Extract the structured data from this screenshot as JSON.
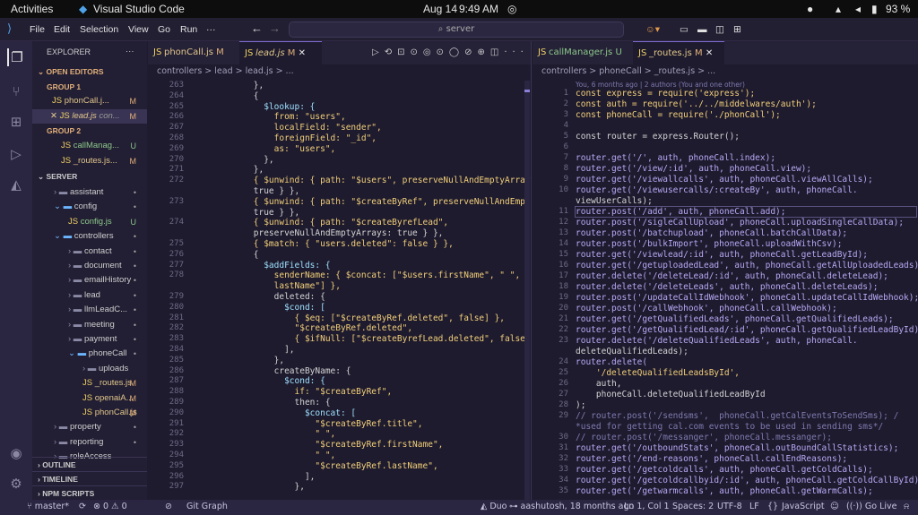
{
  "topbar": {
    "activities": "Activities",
    "app": "Visual Studio Code",
    "date": "Aug 14",
    "time": "9:49 AM",
    "battery": "93 %"
  },
  "menu": {
    "items": [
      "File",
      "Edit",
      "Selection",
      "View",
      "Go",
      "Run"
    ],
    "search": "server"
  },
  "sidebar": {
    "title": "EXPLORER",
    "open_editors": "OPEN EDITORS",
    "group1": "GROUP 1",
    "g1_files": [
      {
        "name": "phonCall.j...",
        "status": "M"
      },
      {
        "name": "lead.js",
        "extra": "con...",
        "status": "M"
      }
    ],
    "group2": "GROUP 2",
    "g2_files": [
      {
        "name": "callManag...",
        "status": "U"
      },
      {
        "name": "_routes.js...",
        "status": "M"
      }
    ],
    "server": "SERVER",
    "tree": [
      {
        "name": "assistant",
        "type": "folder",
        "status": "•"
      },
      {
        "name": "config",
        "type": "folder-open",
        "status": "•"
      },
      {
        "name": "config.js",
        "type": "file",
        "status": "U"
      },
      {
        "name": "controllers",
        "type": "folder-open",
        "status": "•"
      },
      {
        "name": "contact",
        "type": "folder",
        "status": "•"
      },
      {
        "name": "document",
        "type": "folder",
        "status": "•"
      },
      {
        "name": "emailHistory",
        "type": "folder",
        "status": "•"
      },
      {
        "name": "lead",
        "type": "folder",
        "status": "•"
      },
      {
        "name": "llmLeadC...",
        "type": "folder",
        "status": "•"
      },
      {
        "name": "meeting",
        "type": "folder",
        "status": "•"
      },
      {
        "name": "payment",
        "type": "folder",
        "status": "•"
      },
      {
        "name": "phoneCall",
        "type": "folder-open",
        "status": "•"
      },
      {
        "name": "uploads",
        "type": "folder",
        "status": ""
      },
      {
        "name": "_routes.js",
        "type": "file",
        "status": "M"
      },
      {
        "name": "openaiA...",
        "type": "file",
        "status": "M"
      },
      {
        "name": "phonCall.js",
        "type": "file",
        "status": "M"
      },
      {
        "name": "property",
        "type": "folder",
        "status": "•"
      },
      {
        "name": "reporting",
        "type": "folder",
        "status": "•"
      },
      {
        "name": "roleAccess",
        "type": "folder",
        "status": ""
      }
    ],
    "outline": "OUTLINE",
    "timeline": "TIMELINE",
    "npm": "NPM SCRIPTS"
  },
  "left_editor": {
    "tabs": [
      {
        "name": "phonCall.js",
        "status": "M"
      },
      {
        "name": "lead.js",
        "status": "M"
      }
    ],
    "breadcrumb": "controllers > lead > lead.js > ...",
    "lines": [
      [
        "263",
        "        },"
      ],
      [
        "264",
        "        {"
      ],
      [
        "265",
        "          $lookup: {"
      ],
      [
        "266",
        "            from: \"users\","
      ],
      [
        "267",
        "            localField: \"sender\","
      ],
      [
        "268",
        "            foreignField: \"_id\","
      ],
      [
        "269",
        "            as: \"users\","
      ],
      [
        "270",
        "          },"
      ],
      [
        "271",
        "        },"
      ],
      [
        "272",
        "        { $unwind: { path: \"$users\", preserveNullAndEmptyArrays:"
      ],
      [
        "",
        "        true } },"
      ],
      [
        "273",
        "        { $unwind: { path: \"$createByRef\", preserveNullAndEmptyArrays:"
      ],
      [
        "",
        "        true } },"
      ],
      [
        "274",
        "        { $unwind: { path: \"$createByrefLead\","
      ],
      [
        "",
        "        preserveNullAndEmptyArrays: true } },"
      ],
      [
        "275",
        "        { $match: { \"users.deleted\": false } },"
      ],
      [
        "276",
        "        {"
      ],
      [
        "277",
        "          $addFields: {"
      ],
      [
        "278",
        "            senderName: { $concat: [\"$users.firstName\", \" \", \"$users."
      ],
      [
        "",
        "            lastName\"] },"
      ],
      [
        "279",
        "            deleted: {"
      ],
      [
        "280",
        "              $cond: ["
      ],
      [
        "281",
        "                { $eq: [\"$createByRef.deleted\", false] },"
      ],
      [
        "282",
        "                \"$createByRef.deleted\","
      ],
      [
        "283",
        "                { $ifNull: [\"$createByrefLead.deleted\", false] },"
      ],
      [
        "284",
        "              ],"
      ],
      [
        "285",
        "            },"
      ],
      [
        "286",
        "            createByName: {"
      ],
      [
        "287",
        "              $cond: {"
      ],
      [
        "288",
        "                if: \"$createByRef\","
      ],
      [
        "289",
        "                then: {"
      ],
      [
        "290",
        "                  $concat: ["
      ],
      [
        "291",
        "                    \"$createByRef.title\","
      ],
      [
        "292",
        "                    \" \","
      ],
      [
        "293",
        "                    \"$createByRef.firstName\","
      ],
      [
        "294",
        "                    \" \","
      ],
      [
        "295",
        "                    \"$createByRef.lastName\","
      ],
      [
        "296",
        "                  ],"
      ],
      [
        "297",
        "                },"
      ]
    ]
  },
  "right_editor": {
    "tabs": [
      {
        "name": "callManager.js",
        "status": "U"
      },
      {
        "name": "_routes.js",
        "status": "M"
      }
    ],
    "breadcrumb": "controllers > phoneCall > _routes.js > ...",
    "blame": "You, 6 months ago | 2 authors (You and one other)",
    "lines": [
      [
        "1",
        "const express = require('express');"
      ],
      [
        "2",
        "const auth = require('../../middelwares/auth');"
      ],
      [
        "3",
        "const phoneCall = require('./phonCall');"
      ],
      [
        "4",
        ""
      ],
      [
        "5",
        "const router = express.Router();"
      ],
      [
        "6",
        ""
      ],
      [
        "7",
        "router.get('/', auth, phoneCall.index);"
      ],
      [
        "8",
        "router.get('/view/:id', auth, phoneCall.view);"
      ],
      [
        "9",
        "router.get('/viewallcalls', auth, phoneCall.viewAllCalls);"
      ],
      [
        "10",
        "router.get('/viewusercalls/:createBy', auth, phoneCall."
      ],
      [
        "",
        "viewUserCalls);"
      ],
      [
        "11",
        "router.post('/add', auth, phoneCall.add);"
      ],
      [
        "12",
        "router.post('/sigleCallUpload', phoneCall.uploadSingleCallData);"
      ],
      [
        "13",
        "router.post('/batchupload', phoneCall.batchCallData);"
      ],
      [
        "14",
        "router.post('/bulkImport', phoneCall.uploadWithCsv);"
      ],
      [
        "15",
        "router.get('/viewlead/:id', auth, phoneCall.getLeadById);"
      ],
      [
        "16",
        "router.get('/getuploadedLead', auth, phoneCall.getAllUploadedLeads);"
      ],
      [
        "17",
        "router.delete('/deleteLead/:id', auth, phoneCall.deleteLead);"
      ],
      [
        "18",
        "router.delete('/deleteLeads', auth, phoneCall.deleteLeads);"
      ],
      [
        "19",
        "router.post('/updateCallIdWebhook', phoneCall.updateCallIdWebhook);"
      ],
      [
        "20",
        "router.post('/callWebhook', phoneCall.callWebhook);"
      ],
      [
        "21",
        "router.get('/getQualifiedLeads', phoneCall.getQualifiedLeads);"
      ],
      [
        "22",
        "router.get('/getQualifiedLead/:id', phoneCall.getQualifiedLeadById);"
      ],
      [
        "23",
        "router.delete('/deleteQualifiedLeads', auth, phoneCall."
      ],
      [
        "",
        "deleteQualifiedLeads);"
      ],
      [
        "24",
        "router.delete("
      ],
      [
        "25",
        "    '/deleteQualifiedLeadsById',"
      ],
      [
        "26",
        "    auth,"
      ],
      [
        "27",
        "    phoneCall.deleteQualifiedLeadById"
      ],
      [
        "28",
        ");"
      ],
      [
        "29",
        "// router.post('/sendsms',  phoneCall.getCalEventsToSendSms); /"
      ],
      [
        "",
        "*used for getting cal.com events to be used in sending sms*/"
      ],
      [
        "30",
        "// router.post('/messanger', phoneCall.messanger);"
      ],
      [
        "31",
        "router.get('/outboundStats', phoneCall.outBoundCallStatistics);"
      ],
      [
        "32",
        "router.get('/end-reasons', phoneCall.callEndReasons);"
      ],
      [
        "33",
        "router.get('/getcoldcalls', auth, phoneCall.getColdCalls);"
      ],
      [
        "34",
        "router.get('/getcoldcallbyid/:id', auth, phoneCall.getColdCallById);"
      ],
      [
        "35",
        "router.get('/getwarmcalls', auth, phoneCall.getWarmCalls);"
      ]
    ]
  },
  "status": {
    "branch": "master*",
    "errors": "0",
    "warnings": "0",
    "gitgraph": "Git Graph",
    "duo": "Duo",
    "blame": "aashutosh, 18 months ago",
    "position": "Ln 1, Col 1",
    "spaces": "Spaces: 2",
    "encoding": "UTF-8",
    "eol": "LF",
    "braces": "{}",
    "lang": "JavaScript",
    "golive": "Go Live"
  }
}
